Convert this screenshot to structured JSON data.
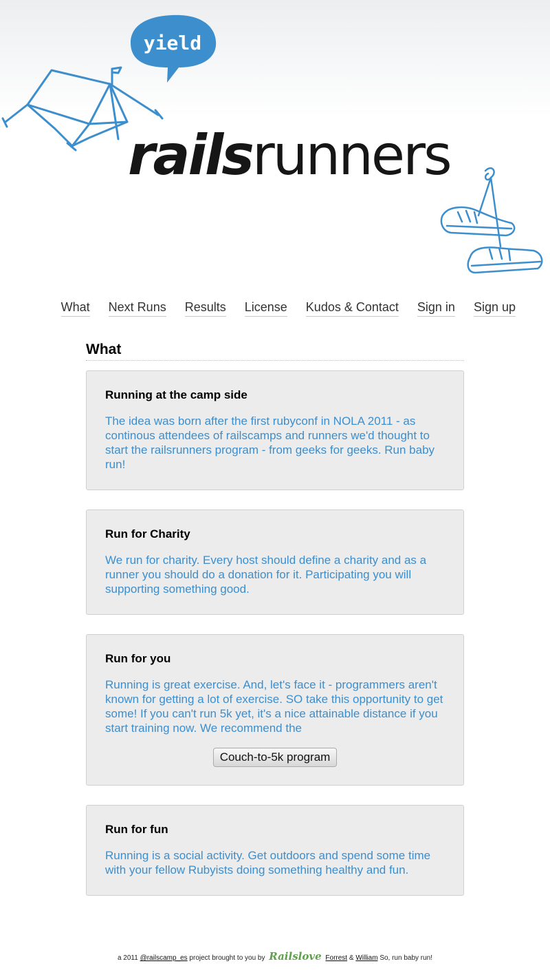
{
  "header": {
    "bubble_text": "yield",
    "logo_bold": "rails",
    "logo_regular": "runners",
    "accent_color": "#3d8ecc"
  },
  "nav": {
    "items": [
      "What",
      "Next Runs",
      "Results",
      "License",
      "Kudos & Contact",
      "Sign in",
      "Sign up"
    ]
  },
  "main": {
    "title": "What",
    "cards": [
      {
        "title": "Running at the camp side",
        "body": "The idea was born after the first rubyconf in NOLA 2011 - as continous attendees of railscamps and runners we'd thought to start the railsrunners program - from geeks for geeks. Run baby run!"
      },
      {
        "title": "Run for Charity",
        "body": "We run for charity. Every host should define a charity and as a runner you should do a donation for it. Participating you will supporting something good."
      },
      {
        "title": "Run for you",
        "body": "Running is great exercise. And, let's face it - programmers aren't known for getting a lot of exercise. SO take this opportunity to get some! If you can't run 5k yet, it's a nice attainable distance if you start training now. We recommend the",
        "button_label": "Couch-to-5k program"
      },
      {
        "title": "Run for fun",
        "body": "Running is a social activity. Get outdoors and spend some time with your fellow Rubyists doing something healthy and fun."
      }
    ]
  },
  "footer": {
    "prefix": "a 2011",
    "railscamp_link": "@railscamp_es",
    "middle": "project brought to you by",
    "railslove": "Railslove",
    "forrest": "Forrest",
    "amp": "&",
    "william": "William",
    "suffix": "So, run baby run!"
  }
}
